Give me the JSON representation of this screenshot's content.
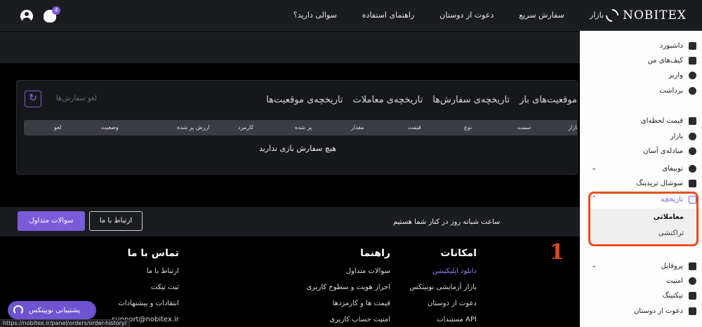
{
  "header": {
    "logo_text": "NOBITEX",
    "nav": [
      "بازار",
      "سفارش سریع",
      "دعوت از دوستان",
      "راهنمای استفاده",
      "سوالی دارید؟"
    ],
    "notification_count": "4"
  },
  "orders_card": {
    "tabs": [
      "موقعیت‌های باز",
      "تاریخچه‌ی سفارش‌ها",
      "تاریخچه‌ی معاملات",
      "تاریخچه‌ی موقعیت‌ها"
    ],
    "cancel_orders_placeholder": "لغو سفارش‌ها",
    "columns": [
      "بازار",
      "سمت",
      "نوع",
      "قیمت",
      "مقدار",
      "پر شده",
      "کارمزد",
      "ارزش پر شده",
      "وضعیت",
      "لغو"
    ],
    "empty_message": "هیچ سفارش بازی ندارید"
  },
  "support_bar": {
    "text": "ساعت شبانه روز در کنار شما هستیم",
    "contact_button": "ارتباط با ما",
    "faq_button": "سوالات متداول"
  },
  "footer": {
    "features": {
      "title": "امکانات",
      "items": [
        "دانلود اپلیکیشن",
        "بازار آزمایشی نوبیتکس",
        "دعوت از دوستان",
        "مستندات API"
      ]
    },
    "guide": {
      "title": "راهنما",
      "items": [
        "سوالات متداول",
        "احراز هویت و سطوح کاربری",
        "قیمت ها و کارمزدها",
        "امنیت حساب کاربری"
      ]
    },
    "contact": {
      "title": "تماس با ما",
      "items": [
        "ارتباط با ما",
        "ثبت تیکت",
        "انتقادات و پیشنهادات",
        "support@nobitex.ir"
      ]
    },
    "annotation": "1"
  },
  "floating_support": {
    "label": "پشتیبانی نوبیتکس"
  },
  "status_url": "https://nobitex.ir/panel/orders/order-history/",
  "sidebar": {
    "items": [
      "داشبورد",
      "کیف‌های من",
      "واریز",
      "برداشت",
      "قیمت لحظه‌ای",
      "بازار",
      "مبادله‌ی آسان",
      "نوبیفای",
      "سوشال تریدینگ",
      "تاریخچه",
      "پروفایل",
      "امنیت",
      "تیکتینگ",
      "دعوت از دوستان"
    ],
    "history_sub": [
      "معاملاتی",
      "تراکنشی"
    ]
  },
  "colors": {
    "accent": "#7a5cd9",
    "highlight": "#e8501c",
    "background": "#000000",
    "panel": "#16171b"
  }
}
